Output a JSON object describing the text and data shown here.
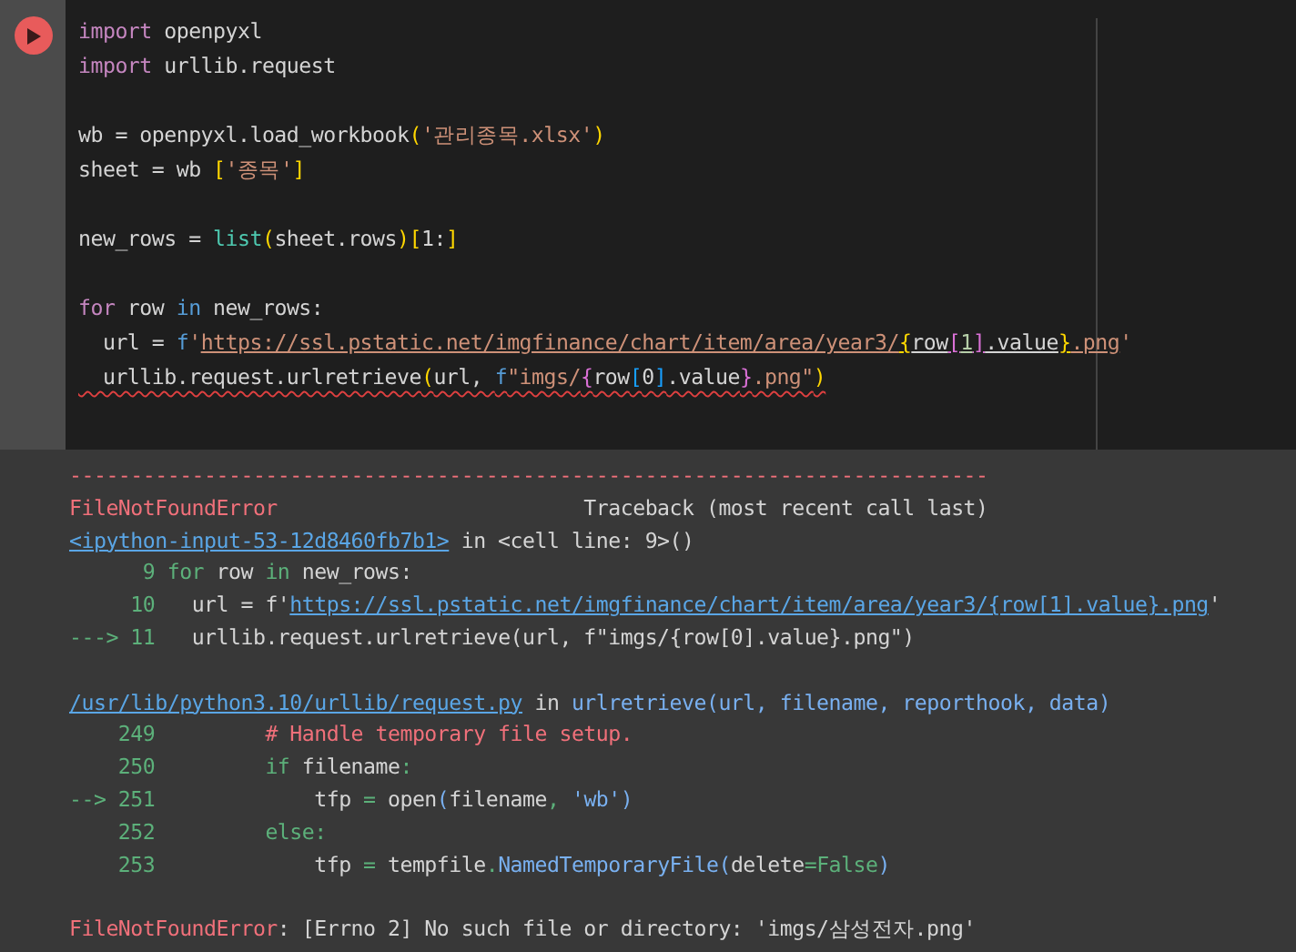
{
  "code_cell": {
    "lines": [
      {
        "kind": "code",
        "tokens": [
          {
            "text": "import",
            "kind": "keyword"
          },
          {
            "text": " openpyxl",
            "kind": "plain"
          }
        ]
      },
      {
        "kind": "code",
        "tokens": [
          {
            "text": "import",
            "kind": "keyword"
          },
          {
            "text": " urllib.request",
            "kind": "plain"
          }
        ]
      },
      {
        "kind": "blank"
      },
      {
        "kind": "code",
        "tokens": [
          {
            "text": "wb = openpyxl.load_workbook",
            "kind": "plain"
          },
          {
            "text": "(",
            "kind": "bracket1"
          },
          {
            "text": "'관리종목.xlsx'",
            "kind": "string"
          },
          {
            "text": ")",
            "kind": "bracket1"
          }
        ]
      },
      {
        "kind": "code",
        "tokens": [
          {
            "text": "sheet = wb ",
            "kind": "plain"
          },
          {
            "text": "[",
            "kind": "bracket1"
          },
          {
            "text": "'종목'",
            "kind": "string"
          },
          {
            "text": "]",
            "kind": "bracket1"
          }
        ]
      },
      {
        "kind": "blank"
      },
      {
        "kind": "code",
        "tokens": [
          {
            "text": "new_rows = ",
            "kind": "plain"
          },
          {
            "text": "list",
            "kind": "builtin"
          },
          {
            "text": "(",
            "kind": "bracket1"
          },
          {
            "text": "sheet.rows",
            "kind": "plain"
          },
          {
            "text": ")",
            "kind": "bracket1"
          },
          {
            "text": "[",
            "kind": "bracket1"
          },
          {
            "text": "1:",
            "kind": "plain"
          },
          {
            "text": "]",
            "kind": "bracket1"
          }
        ]
      },
      {
        "kind": "blank"
      },
      {
        "kind": "code",
        "tokens": [
          {
            "text": "for",
            "kind": "keyword"
          },
          {
            "text": " row ",
            "kind": "plain"
          },
          {
            "text": "in",
            "kind": "operator"
          },
          {
            "text": " new_rows:",
            "kind": "plain"
          }
        ]
      },
      {
        "kind": "code",
        "tokens": [
          {
            "text": "  url = ",
            "kind": "plain"
          },
          {
            "text": "f",
            "kind": "operator"
          },
          {
            "text": "'",
            "kind": "string"
          },
          {
            "text": "https://ssl.pstatic.net/imgfinance/chart/item/area/year3/",
            "kind": "url"
          },
          {
            "text": "{",
            "kind": "bracket1url"
          },
          {
            "text": "row",
            "kind": "plainurl"
          },
          {
            "text": "[",
            "kind": "bracket2url"
          },
          {
            "text": "1",
            "kind": "numberurl"
          },
          {
            "text": "]",
            "kind": "bracket2url"
          },
          {
            "text": ".value",
            "kind": "plainurl"
          },
          {
            "text": "}",
            "kind": "bracket1url"
          },
          {
            "text": ".png",
            "kind": "url"
          },
          {
            "text": "'",
            "kind": "string"
          }
        ]
      },
      {
        "kind": "code",
        "error": true,
        "tokens": [
          {
            "text": "  urllib.request.urlretrieve",
            "kind": "plain"
          },
          {
            "text": "(",
            "kind": "bracket1"
          },
          {
            "text": "url, ",
            "kind": "plain"
          },
          {
            "text": "f",
            "kind": "operator"
          },
          {
            "text": "\"imgs/",
            "kind": "string"
          },
          {
            "text": "{",
            "kind": "bracket2"
          },
          {
            "text": "row",
            "kind": "plain"
          },
          {
            "text": "[",
            "kind": "bracket3"
          },
          {
            "text": "0",
            "kind": "plain"
          },
          {
            "text": "]",
            "kind": "bracket3"
          },
          {
            "text": ".value",
            "kind": "plain"
          },
          {
            "text": "}",
            "kind": "bracket2"
          },
          {
            "text": ".png\"",
            "kind": "string"
          },
          {
            "text": ")",
            "kind": "bracket1"
          }
        ]
      }
    ]
  },
  "output": {
    "lines": [
      {
        "kind": "code",
        "tokens": [
          {
            "text": "---------------------------------------------------------------------------",
            "kind": "error"
          }
        ]
      },
      {
        "kind": "code",
        "tokens": [
          {
            "text": "FileNotFoundError",
            "kind": "error"
          },
          {
            "text": "                         Traceback (most recent call last)",
            "kind": "plain"
          }
        ]
      },
      {
        "kind": "code",
        "tokens": [
          {
            "text": "<ipython-input-53-12d8460fb7b1>",
            "kind": "link"
          },
          {
            "text": " in <cell line: 9>()",
            "kind": "plain"
          }
        ]
      },
      {
        "kind": "code",
        "tokens": [
          {
            "text": "      9 ",
            "kind": "lineno"
          },
          {
            "text": "for",
            "kind": "keyword"
          },
          {
            "text": " row ",
            "kind": "plain"
          },
          {
            "text": "in",
            "kind": "keyword"
          },
          {
            "text": " new_rows:",
            "kind": "plain"
          }
        ]
      },
      {
        "kind": "code",
        "tokens": [
          {
            "text": "     10   ",
            "kind": "lineno"
          },
          {
            "text": "url = f'",
            "kind": "plain"
          },
          {
            "text": "https://ssl.pstatic.net/imgfinance/chart/item/area/year3/{row[1].value}.png",
            "kind": "link"
          },
          {
            "text": "'",
            "kind": "plain"
          }
        ]
      },
      {
        "kind": "code",
        "tokens": [
          {
            "text": "---> 11   ",
            "kind": "lineno"
          },
          {
            "text": "urllib.request.urlretrieve(url, f\"imgs/{row[0].value}.png\")",
            "kind": "plain"
          }
        ]
      },
      {
        "kind": "blank"
      },
      {
        "kind": "code",
        "tokens": [
          {
            "text": "/usr/lib/python3.10/urllib/request.py",
            "kind": "link"
          },
          {
            "text": " in ",
            "kind": "plain"
          },
          {
            "text": "urlretrieve(url, filename, reporthook, data)",
            "kind": "function"
          }
        ]
      },
      {
        "kind": "code",
        "tokens": [
          {
            "text": "    249         ",
            "kind": "lineno"
          },
          {
            "text": "# Handle temporary file setup.",
            "kind": "comment"
          }
        ]
      },
      {
        "kind": "code",
        "tokens": [
          {
            "text": "    250         ",
            "kind": "lineno"
          },
          {
            "text": "if",
            "kind": "keyword"
          },
          {
            "text": " filename",
            "kind": "plain"
          },
          {
            "text": ":",
            "kind": "keyword"
          }
        ]
      },
      {
        "kind": "code",
        "tokens": [
          {
            "text": "--> 251             ",
            "kind": "lineno"
          },
          {
            "text": "tfp ",
            "kind": "plain"
          },
          {
            "text": "=",
            "kind": "keyword"
          },
          {
            "text": " open",
            "kind": "plain"
          },
          {
            "text": "(",
            "kind": "function"
          },
          {
            "text": "filename",
            "kind": "plain"
          },
          {
            "text": ",",
            "kind": "keyword"
          },
          {
            "text": " 'wb'",
            "kind": "function"
          },
          {
            "text": ")",
            "kind": "function"
          }
        ]
      },
      {
        "kind": "code",
        "tokens": [
          {
            "text": "    252         ",
            "kind": "lineno"
          },
          {
            "text": "else:",
            "kind": "keyword"
          }
        ]
      },
      {
        "kind": "code",
        "tokens": [
          {
            "text": "    253             ",
            "kind": "lineno"
          },
          {
            "text": "tfp ",
            "kind": "plain"
          },
          {
            "text": "=",
            "kind": "keyword"
          },
          {
            "text": " tempfile",
            "kind": "plain"
          },
          {
            "text": ".",
            "kind": "keyword"
          },
          {
            "text": "NamedTemporaryFile",
            "kind": "function"
          },
          {
            "text": "(",
            "kind": "function"
          },
          {
            "text": "delete",
            "kind": "plain"
          },
          {
            "text": "=",
            "kind": "keyword"
          },
          {
            "text": "False",
            "kind": "keyword"
          },
          {
            "text": ")",
            "kind": "function"
          }
        ]
      },
      {
        "kind": "blank"
      },
      {
        "kind": "code",
        "tokens": [
          {
            "text": "FileNotFoundError",
            "kind": "error"
          },
          {
            "text": ": [Errno 2] No such file or directory: 'imgs/삼성전자.png'",
            "kind": "plain"
          }
        ]
      }
    ]
  }
}
